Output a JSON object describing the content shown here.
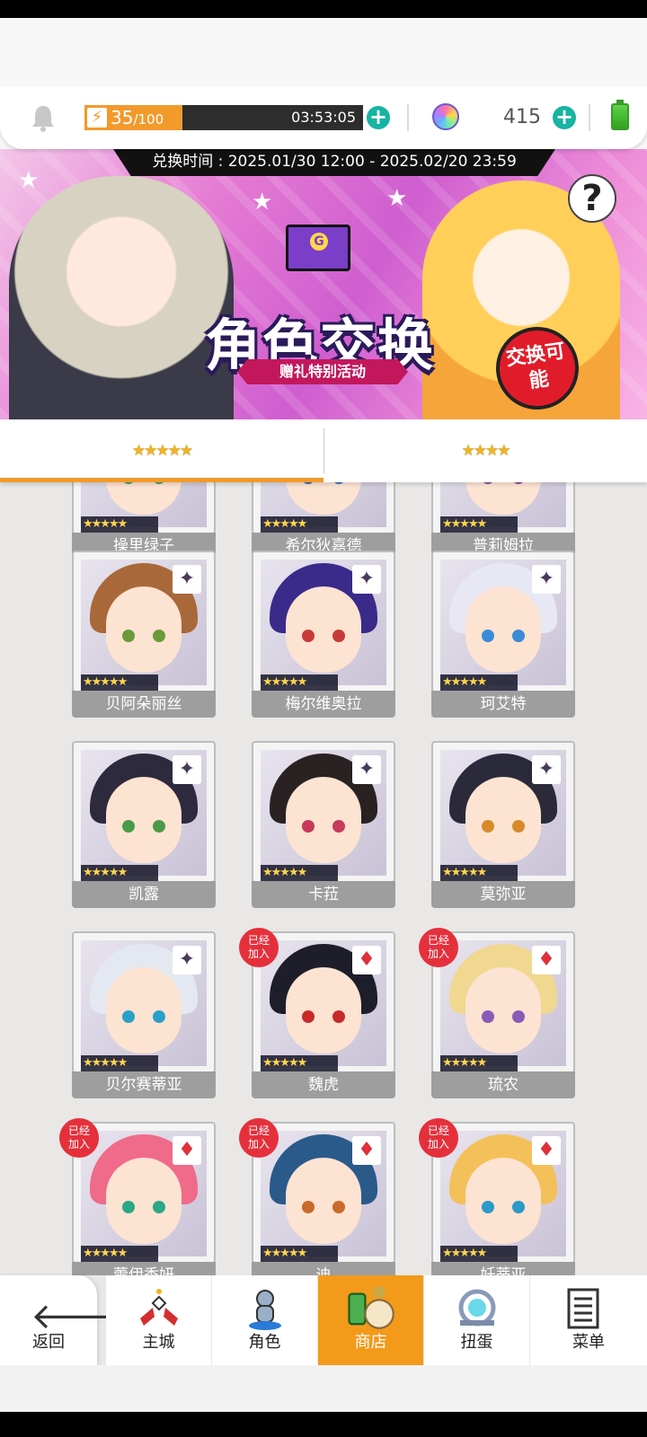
{
  "resources": {
    "stamina_current": "35",
    "stamina_max": "/100",
    "stamina_fraction": 0.35,
    "stamina_timer": "03:53:05",
    "gem_count": "415"
  },
  "banner": {
    "period": "兑换时间 : 2025.01/30 12:00 - 2025.02/20 23:59",
    "title": "角色交换",
    "subtitle": "赠礼特别活动",
    "badge": "交换可能",
    "help": "?"
  },
  "tabs": [
    {
      "label": "★★★★★",
      "active": true
    },
    {
      "label": "★★★★",
      "active": false
    }
  ],
  "cards": [
    {
      "name": "操里绿子",
      "joined": false,
      "suit": "dark",
      "hair": "#3a3a52",
      "eye": "#4a9a6a"
    },
    {
      "name": "希尔狄嘉德",
      "joined": false,
      "suit": "dark",
      "hair": "#6a7aa8",
      "eye": "#3a6aba"
    },
    {
      "name": "普莉姆拉",
      "joined": false,
      "suit": "dark",
      "hair": "#7a5a8a",
      "eye": "#8a4aa8"
    },
    {
      "name": "贝阿朵丽丝",
      "joined": false,
      "suit": "dark",
      "hair": "#a8683a",
      "eye": "#6a9a3a"
    },
    {
      "name": "梅尔维奥拉",
      "joined": false,
      "suit": "dark",
      "hair": "#3a2a8a",
      "eye": "#c83a3a"
    },
    {
      "name": "珂艾特",
      "joined": false,
      "suit": "dark",
      "hair": "#e8e8f4",
      "eye": "#3a8ad8"
    },
    {
      "name": "凯露",
      "joined": false,
      "suit": "dark",
      "hair": "#2e2a3e",
      "eye": "#4a9a4a"
    },
    {
      "name": "卡菈",
      "joined": false,
      "suit": "dark",
      "hair": "#2a2222",
      "eye": "#c83a5a"
    },
    {
      "name": "莫弥亚",
      "joined": false,
      "suit": "dark",
      "hair": "#2a2a3a",
      "eye": "#d88a2a"
    },
    {
      "name": "贝尔赛蒂亚",
      "joined": false,
      "suit": "dark",
      "hair": "#e4e8f0",
      "eye": "#2aa0c8"
    },
    {
      "name": "魏虎",
      "joined": true,
      "suit": "red",
      "hair": "#1e1e2a",
      "eye": "#c82a2a"
    },
    {
      "name": "琉农",
      "joined": true,
      "suit": "red",
      "hair": "#f0d890",
      "eye": "#8a5ab8"
    },
    {
      "name": "蕾伊香妍",
      "joined": true,
      "suit": "red",
      "hair": "#f06a8a",
      "eye": "#2aa888"
    },
    {
      "name": "迪",
      "joined": true,
      "suit": "red",
      "hair": "#2a5a8a",
      "eye": "#c86a2a"
    },
    {
      "name": "妊蒂亚",
      "joined": true,
      "suit": "red",
      "hair": "#f4c05a",
      "eye": "#2a9ac8"
    }
  ],
  "joined_label": "已经加入",
  "rarity_stars": "★★★★★",
  "nav": {
    "back": "返回",
    "items": [
      "主城",
      "角色",
      "商店",
      "扭蛋",
      "菜单"
    ],
    "active_index": 2
  },
  "colors": {
    "accent": "#f29a2b",
    "plus": "#16b4a2",
    "joined_badge": "#e5303c",
    "name_plate": "#9e9e9e"
  },
  "icons": [
    "bell-icon",
    "lightning-icon",
    "plus-icon",
    "gem-icon",
    "battery-icon",
    "help-icon",
    "back-arrow-icon",
    "castle-icon",
    "character-icon",
    "shop-icon",
    "gacha-icon",
    "menu-icon"
  ]
}
